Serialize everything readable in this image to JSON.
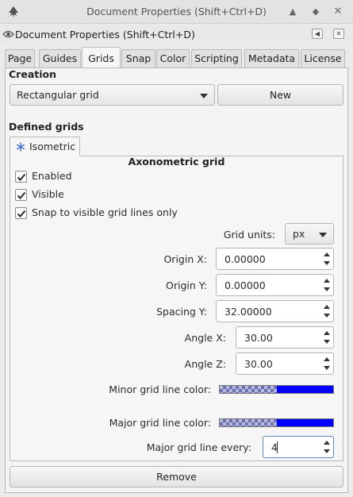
{
  "window": {
    "title": "Document Properties (Shift+Ctrl+D)",
    "controls": [
      "minimize-icon",
      "restore-icon",
      "close-icon"
    ]
  },
  "dock": {
    "title": "Document Properties (Shift+Ctrl+D)"
  },
  "tabs": [
    "Page",
    "Guides",
    "Grids",
    "Snap",
    "Color",
    "Scripting",
    "Metadata",
    "License"
  ],
  "active_tab": "Grids",
  "creation": {
    "heading": "Creation",
    "grid_type": "Rectangular grid",
    "new_label": "New"
  },
  "defined": {
    "heading": "Defined grids",
    "grid_tab_label": "Isometric",
    "grid_title": "Axonometric grid",
    "enabled_label": "Enabled",
    "enabled": true,
    "visible_label": "Visible",
    "visible": true,
    "snap_label": "Snap to visible grid lines only",
    "snap": true,
    "units_label": "Grid units:",
    "units_value": "px",
    "origin_x_label": "Origin X:",
    "origin_x_value": "0.00000",
    "origin_y_label": "Origin Y:",
    "origin_y_value": "0.00000",
    "spacing_y_label": "Spacing Y:",
    "spacing_y_value": "32.00000",
    "angle_x_label": "Angle X:",
    "angle_x_value": "30.00",
    "angle_z_label": "Angle Z:",
    "angle_z_value": "30.00",
    "minor_color_label": "Minor grid line color:",
    "minor_color": "#0000ff",
    "major_color_label": "Major grid line color:",
    "major_color": "#0000ff",
    "major_every_label": "Major grid line every:",
    "major_every_value": "4",
    "remove_label": "Remove"
  },
  "colors": {
    "accent": "#5c89c9",
    "check": "#2b2b2b"
  }
}
